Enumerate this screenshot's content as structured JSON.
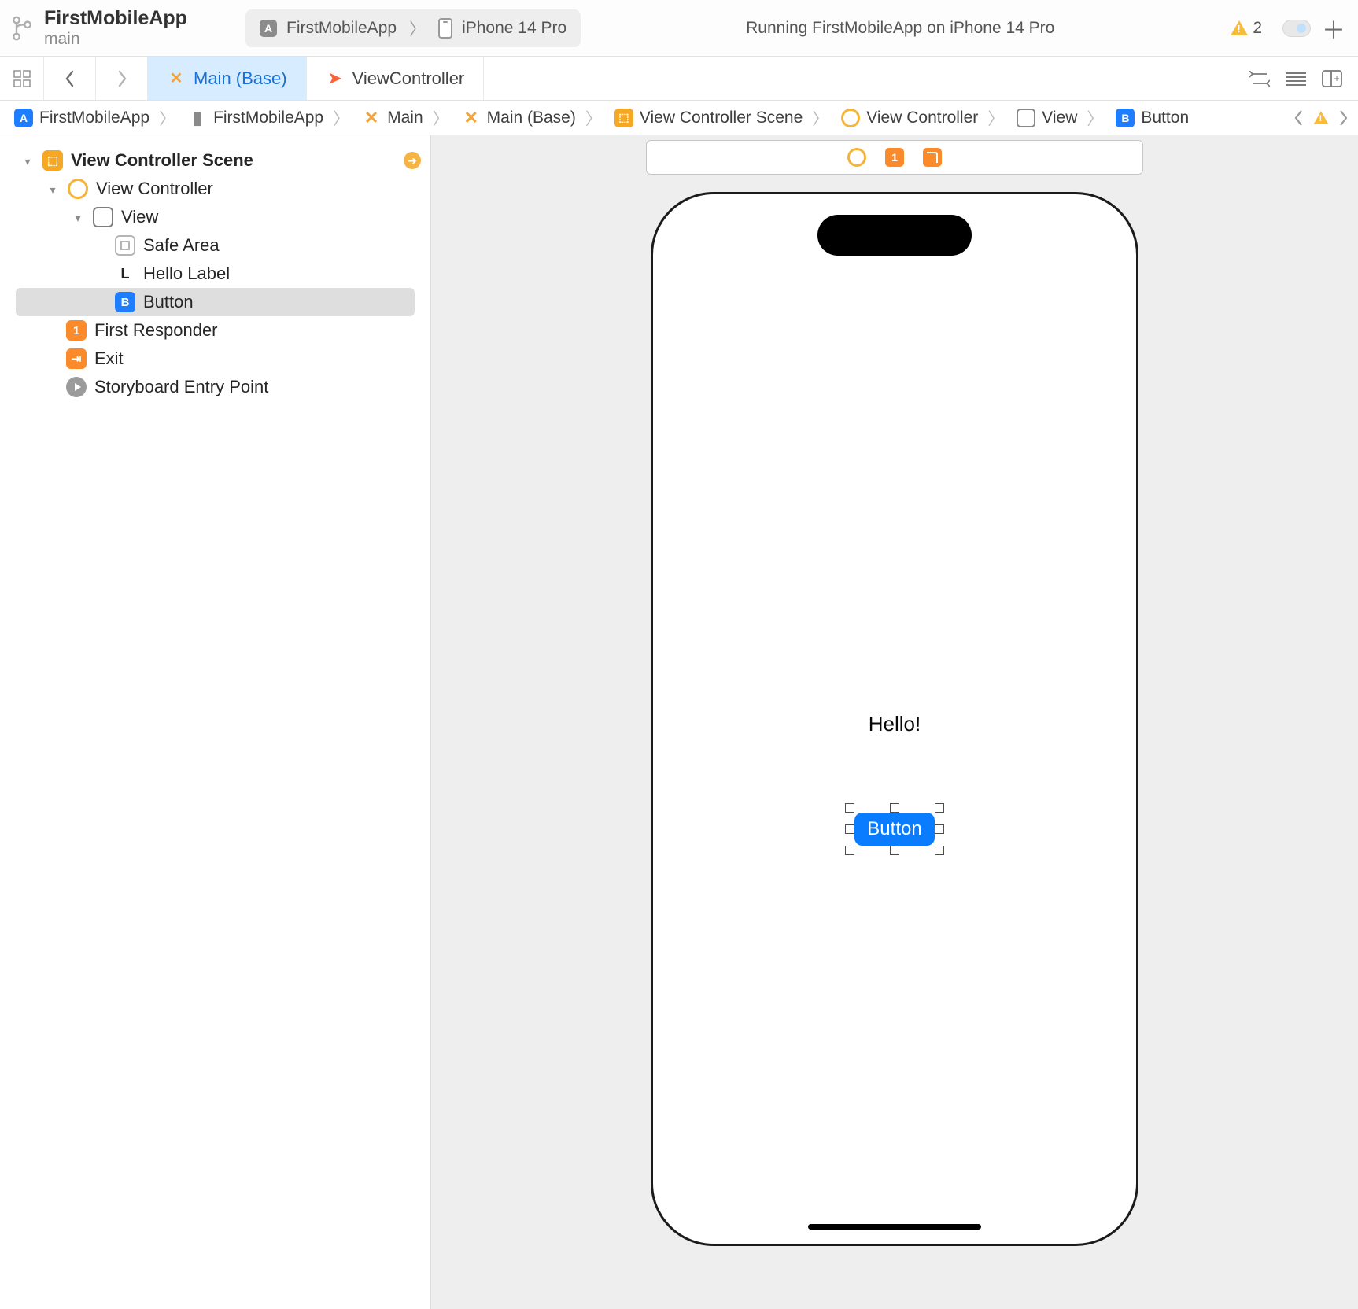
{
  "toolbar": {
    "project": "FirstMobileApp",
    "branch": "main",
    "scheme": "FirstMobileApp",
    "device": "iPhone 14 Pro",
    "status": "Running FirstMobileApp on iPhone 14 Pro",
    "warnings": "2"
  },
  "tabs": {
    "main": "Main (Base)",
    "vc": "ViewController"
  },
  "breadcrumb": {
    "c0": "FirstMobileApp",
    "c1": "FirstMobileApp",
    "c2": "Main",
    "c3": "Main (Base)",
    "c4": "View Controller Scene",
    "c5": "View Controller",
    "c6": "View",
    "c7": "Button"
  },
  "outline": {
    "scene": "View Controller Scene",
    "vc": "View Controller",
    "view": "View",
    "safe": "Safe Area",
    "hello": "Hello Label",
    "button": "Button",
    "first": "First Responder",
    "exit": "Exit",
    "entry": "Storyboard Entry Point"
  },
  "canvas": {
    "hello": "Hello!",
    "button": "Button",
    "dock_one": "1"
  }
}
